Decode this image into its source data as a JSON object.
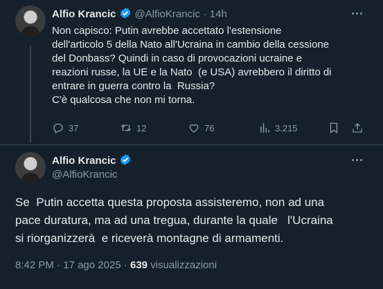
{
  "tweet1": {
    "author_name": "Alfio Krancic",
    "handle": "@AlfioKrancic",
    "separator": "·",
    "time_ago": "14h",
    "text": "Non capisco: Putin avrebbe accettato l'estensione\ndell'articolo 5 della Nato all'Ucraina in cambio della cessione\ndel Donbass? Quindi in caso di provocazioni ucraine e\nreazioni russe, la UE e la Nato  (e USA) avrebbero il diritto di\nentrare in guerra contro la  Russia?\nC'è qualcosa che non mi torna.",
    "replies": "37",
    "reposts": "12",
    "likes": "76",
    "views": "3.215"
  },
  "tweet2": {
    "author_name": "Alfio Krancic",
    "handle": "@AlfioKrancic",
    "text": "Se  Putin accetta questa proposta assisteremo, non ad una\npace duratura, ma ad una tregua, durante la quale   l'Ucraina\nsi riorganizzerà  e riceverà montagne di armamenti.",
    "time": "8:42 PM",
    "date": "17 ago 2025",
    "separator": "·",
    "views_count": "639",
    "views_label": "visualizzazioni"
  },
  "icons": {
    "verified_color": "#1d9bf0",
    "icon_color": "#8b98a5"
  }
}
